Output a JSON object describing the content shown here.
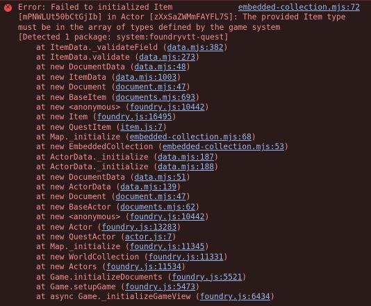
{
  "error": {
    "summary": "Error: Failed to initialized Item",
    "source": "embedded-collection.mjs:72",
    "lines": [
      "[mPNWLUt50bCtGjIb] in Actor [zXxSaZWMmFAYFL7S]: The provided Item type",
      "must be in the array of types defined by the game system",
      "[Detected 1 package: system:foundryvtt-quest]"
    ]
  },
  "stack": [
    {
      "fn": "at ItemData._validateField",
      "loc": "data.mjs:382"
    },
    {
      "fn": "at ItemData.validate",
      "loc": "data.mjs:273"
    },
    {
      "fn": "at new DocumentData",
      "loc": "data.mjs:48"
    },
    {
      "fn": "at new ItemData",
      "loc": "data.mjs:1003"
    },
    {
      "fn": "at new Document",
      "loc": "document.mjs:47"
    },
    {
      "fn": "at new BaseItem",
      "loc": "documents.mjs:693"
    },
    {
      "fn": "at new <anonymous>",
      "loc": "foundry.js:10442"
    },
    {
      "fn": "at new Item",
      "loc": "foundry.js:16495"
    },
    {
      "fn": "at new QuestItem",
      "loc": "item.js:7"
    },
    {
      "fn": "at Map._initialize",
      "loc": "embedded-collection.mjs:68"
    },
    {
      "fn": "at new EmbeddedCollection",
      "loc": "embedded-collection.mjs:53"
    },
    {
      "fn": "at ActorData._initialize",
      "loc": "data.mjs:187"
    },
    {
      "fn": "at ActorData._initialize",
      "loc": "data.mjs:188"
    },
    {
      "fn": "at new DocumentData",
      "loc": "data.mjs:51"
    },
    {
      "fn": "at new ActorData",
      "loc": "data.mjs:139"
    },
    {
      "fn": "at new Document",
      "loc": "document.mjs:47"
    },
    {
      "fn": "at new BaseActor",
      "loc": "documents.mjs:62"
    },
    {
      "fn": "at new <anonymous>",
      "loc": "foundry.js:10442"
    },
    {
      "fn": "at new Actor",
      "loc": "foundry.js:13283"
    },
    {
      "fn": "at new QuestActor",
      "loc": "actor.js:7"
    },
    {
      "fn": "at Map._initialize",
      "loc": "foundry.js:11345"
    },
    {
      "fn": "at new WorldCollection",
      "loc": "foundry.js:11331"
    },
    {
      "fn": "at new Actors",
      "loc": "foundry.js:11534"
    },
    {
      "fn": "at Game.initializeDocuments",
      "loc": "foundry.js:5521"
    },
    {
      "fn": "at Game.setupGame",
      "loc": "foundry.js:5473"
    },
    {
      "fn": "at async Game._initializeGameView",
      "loc": "foundry.js:6434"
    }
  ],
  "colors": {
    "background": "#2a1a1a",
    "error_text": "#f48a8a",
    "link": "#9ab6ee",
    "icon": "#e5484d"
  },
  "icons": {
    "error": "error-circle-icon"
  }
}
